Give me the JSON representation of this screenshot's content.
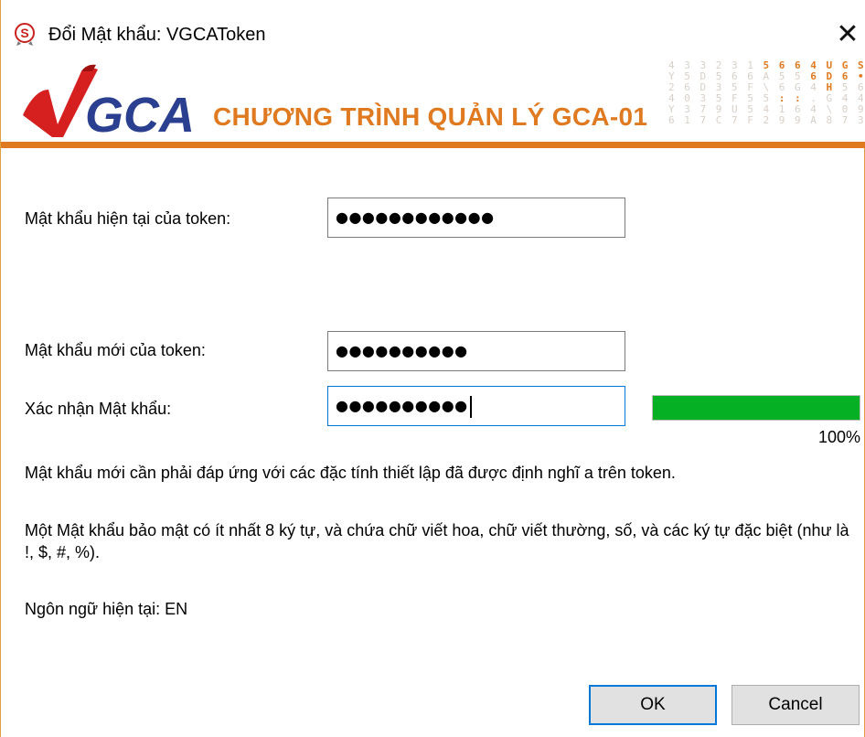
{
  "window": {
    "title": "Đổi Mật khẩu: VGCAToken",
    "app_icon": "s-shield-icon",
    "close_glyph": "✕"
  },
  "banner": {
    "logo_text": "VGCA",
    "title": "CHƯƠNG TRÌNH QUẢN LÝ GCA-01",
    "accent_color": "#e07a20"
  },
  "form": {
    "current_password": {
      "label": "Mật khẩu hiện tại của token:",
      "value_masked": "●●●●●●●●●●●●"
    },
    "new_password": {
      "label": "Mật khẩu mới của token:",
      "value_masked": "●●●●●●●●●●"
    },
    "confirm_password": {
      "label": "Xác nhận Mật khẩu:",
      "value_masked": "●●●●●●●●●●"
    },
    "strength": {
      "percent": 100,
      "label": "100%",
      "color": "#06b025"
    }
  },
  "info": {
    "requirement_note": "Mật khẩu mới cần phải đáp ứng với các đặc tính thiết lập đã được định nghĩ a trên token.",
    "policy_note": "Một Mật khẩu bảo mật có ít nhất 8 ký tự, và chứa chữ viết hoa, chữ viết thường, số, và các ký tự đặc biệt (như là !, $, #, %).",
    "language_label": "Ngôn ngữ hiện tại:",
    "language_value": "EN"
  },
  "buttons": {
    "ok": "OK",
    "cancel": "Cancel"
  }
}
